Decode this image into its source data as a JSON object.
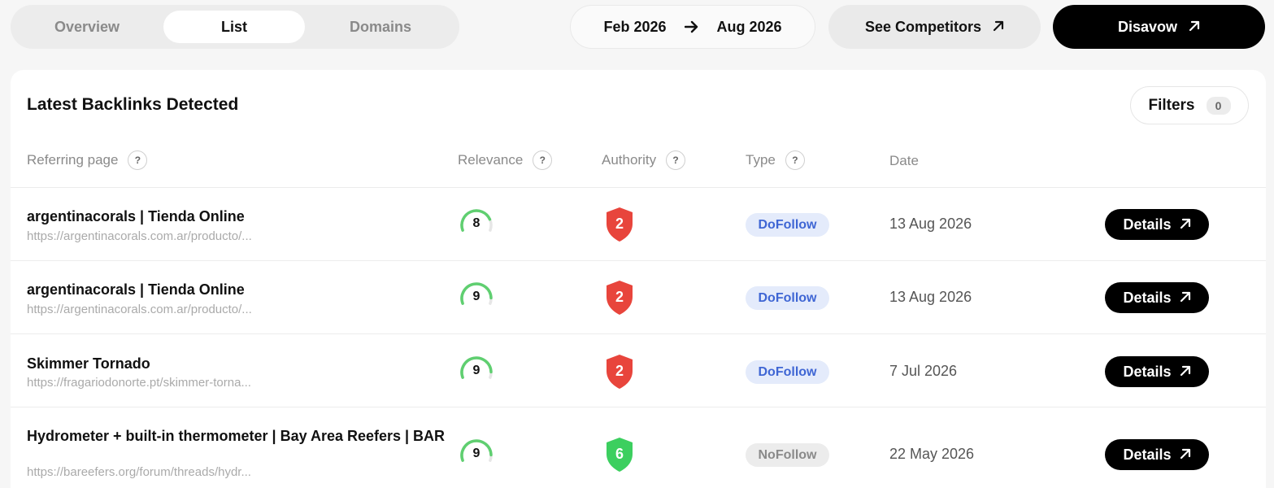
{
  "tabs": [
    {
      "label": "Overview",
      "active": false
    },
    {
      "label": "List",
      "active": true
    },
    {
      "label": "Domains",
      "active": false
    }
  ],
  "date_range": {
    "from": "Feb 2026",
    "to": "Aug 2026"
  },
  "header_buttons": {
    "competitors": "See Competitors",
    "disavow": "Disavow"
  },
  "card": {
    "title": "Latest Backlinks Detected",
    "filters_label": "Filters",
    "filters_count": "0"
  },
  "columns": {
    "referring": "Referring page",
    "relevance": "Relevance",
    "authority": "Authority",
    "type": "Type",
    "date": "Date",
    "help_glyph": "?"
  },
  "rows": [
    {
      "title": "argentinacorals | Tienda Online",
      "url": "https://argentinacorals.com.ar/producto/...",
      "relevance": "8",
      "relevance_fraction": 0.8,
      "authority": "2",
      "authority_color": "#e8453c",
      "type": "DoFollow",
      "date": "13 Aug 2026",
      "details": "Details"
    },
    {
      "title": "argentinacorals | Tienda Online",
      "url": "https://argentinacorals.com.ar/producto/...",
      "relevance": "9",
      "relevance_fraction": 0.9,
      "authority": "2",
      "authority_color": "#e8453c",
      "type": "DoFollow",
      "date": "13 Aug 2026",
      "details": "Details"
    },
    {
      "title": "Skimmer Tornado",
      "url": "https://fragariodonorte.pt/skimmer-torna...",
      "relevance": "9",
      "relevance_fraction": 0.9,
      "authority": "2",
      "authority_color": "#e8453c",
      "type": "DoFollow",
      "date": "7 Jul 2026",
      "details": "Details"
    },
    {
      "title": "Hydrometer + built-in thermometer | Bay Area Reefers | BAR",
      "url": "https://bareefers.org/forum/threads/hydr...",
      "relevance": "9",
      "relevance_fraction": 0.9,
      "authority": "6",
      "authority_color": "#3ccf5f",
      "type": "NoFollow",
      "date": "22 May 2026",
      "details": "Details"
    }
  ],
  "colors": {
    "gauge_green": "#5fcf70",
    "gauge_track": "#e6e6e6",
    "dofollow_bg": "#e4ebfb",
    "dofollow_text": "#3f66d4",
    "nofollow_bg": "#ececec",
    "nofollow_text": "#8a8a8a"
  },
  "icons": {
    "date_arrow": "arrow-right-icon",
    "external": "arrow-up-right-icon",
    "relevance": "gauge-icon",
    "authority": "shield-icon"
  }
}
